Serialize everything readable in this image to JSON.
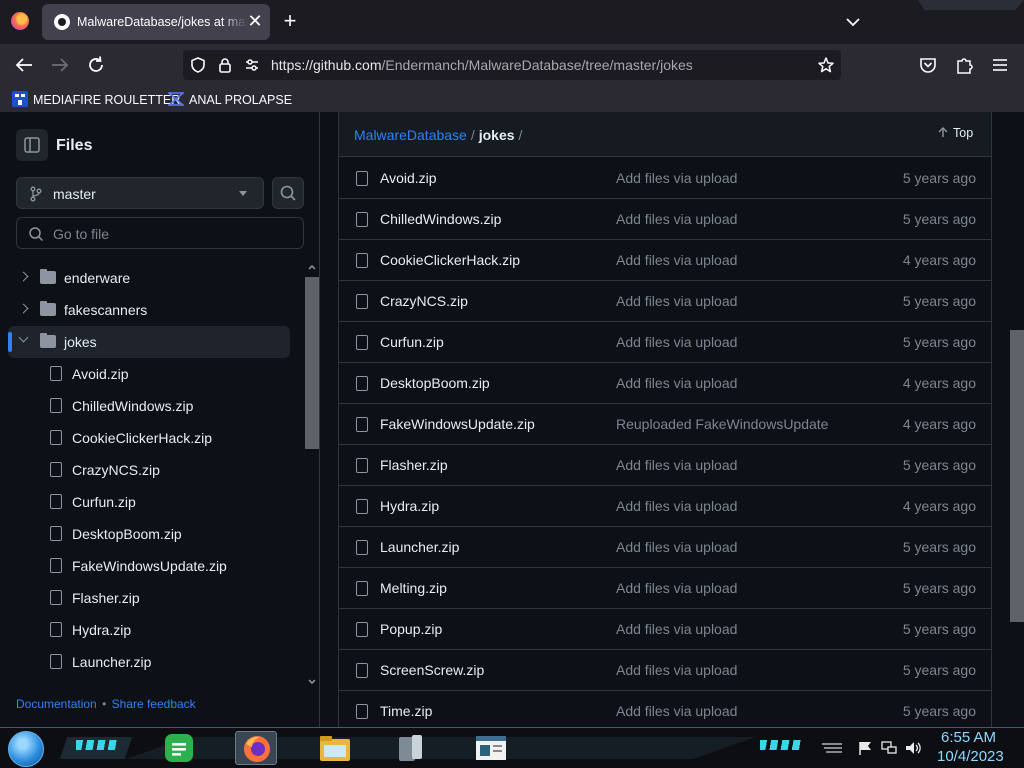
{
  "browser": {
    "tab_title": "MalwareDatabase/jokes at master",
    "tab_close": "✕",
    "new_tab": "+",
    "url_host": "https://github.com",
    "url_path": "/Endermanch/MalwareDatabase/tree/master/jokes",
    "bookmarks": [
      {
        "label": "MEDIAFIRE ROULETTER",
        "icon": "mediafire-icon"
      },
      {
        "label": "ANAL PROLAPSE",
        "icon": "bookmark-site-icon"
      }
    ]
  },
  "sidebar": {
    "title": "Files",
    "branch": "master",
    "goto_placeholder": "Go to file",
    "tree": [
      {
        "label": "enderware",
        "type": "folder",
        "open": false
      },
      {
        "label": "fakescanners",
        "type": "folder",
        "open": false
      },
      {
        "label": "jokes",
        "type": "folder",
        "open": true,
        "active": true
      },
      {
        "label": "Avoid.zip",
        "type": "file"
      },
      {
        "label": "ChilledWindows.zip",
        "type": "file"
      },
      {
        "label": "CookieClickerHack.zip",
        "type": "file"
      },
      {
        "label": "CrazyNCS.zip",
        "type": "file"
      },
      {
        "label": "Curfun.zip",
        "type": "file"
      },
      {
        "label": "DesktopBoom.zip",
        "type": "file"
      },
      {
        "label": "FakeWindowsUpdate.zip",
        "type": "file"
      },
      {
        "label": "Flasher.zip",
        "type": "file"
      },
      {
        "label": "Hydra.zip",
        "type": "file"
      },
      {
        "label": "Launcher.zip",
        "type": "file"
      }
    ],
    "footer_docs": "Documentation",
    "footer_sep": "•",
    "footer_feedback": "Share feedback"
  },
  "main": {
    "breadcrumb_repo": "MalwareDatabase",
    "breadcrumb_sep": "/",
    "breadcrumb_current": "jokes",
    "breadcrumb_trailing": "/",
    "top_label": "Top",
    "files": [
      {
        "name": "Avoid.zip",
        "message": "Add files via upload",
        "age": "5 years ago"
      },
      {
        "name": "ChilledWindows.zip",
        "message": "Add files via upload",
        "age": "5 years ago"
      },
      {
        "name": "CookieClickerHack.zip",
        "message": "Add files via upload",
        "age": "4 years ago"
      },
      {
        "name": "CrazyNCS.zip",
        "message": "Add files via upload",
        "age": "5 years ago"
      },
      {
        "name": "Curfun.zip",
        "message": "Add files via upload",
        "age": "5 years ago"
      },
      {
        "name": "DesktopBoom.zip",
        "message": "Add files via upload",
        "age": "4 years ago"
      },
      {
        "name": "FakeWindowsUpdate.zip",
        "message": "Reuploaded FakeWindowsUpdate",
        "age": "4 years ago"
      },
      {
        "name": "Flasher.zip",
        "message": "Add files via upload",
        "age": "5 years ago"
      },
      {
        "name": "Hydra.zip",
        "message": "Add files via upload",
        "age": "4 years ago"
      },
      {
        "name": "Launcher.zip",
        "message": "Add files via upload",
        "age": "5 years ago"
      },
      {
        "name": "Melting.zip",
        "message": "Add files via upload",
        "age": "5 years ago"
      },
      {
        "name": "Popup.zip",
        "message": "Add files via upload",
        "age": "5 years ago"
      },
      {
        "name": "ScreenScrew.zip",
        "message": "Add files via upload",
        "age": "5 years ago"
      },
      {
        "name": "Time.zip",
        "message": "Add files via upload",
        "age": "5 years ago"
      }
    ]
  },
  "taskbar": {
    "apps": [
      "feedly-icon",
      "firefox-icon",
      "file-explorer-icon",
      "recycle-bin-icon",
      "notepad-icon"
    ],
    "time": "6:55 AM",
    "date": "10/4/2023"
  },
  "colors": {
    "accent": "#2f81f7",
    "bg": "#0d1117",
    "border": "#30363d",
    "text": "#e6edf3",
    "muted": "#7d8590"
  }
}
